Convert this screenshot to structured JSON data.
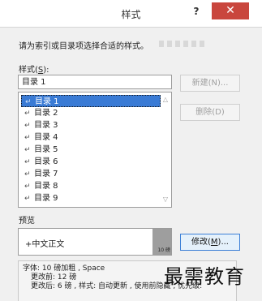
{
  "dialog": {
    "title": "样式",
    "help_label": "?",
    "close_label": "✕"
  },
  "instruction": "请为索引或目录项选择合适的样式。",
  "styles": {
    "label": "样式(",
    "label_key": "S",
    "label_end": "):",
    "current_value": "目录 1",
    "items": [
      {
        "label": "目录 1",
        "selected": true
      },
      {
        "label": "目录 2"
      },
      {
        "label": "目录 3"
      },
      {
        "label": "目录 4"
      },
      {
        "label": "目录 5"
      },
      {
        "label": "目录 6"
      },
      {
        "label": "目录 7"
      },
      {
        "label": "目录 8"
      },
      {
        "label": "目录 9"
      }
    ],
    "item_mark": "↵"
  },
  "buttons": {
    "new_label": "新建(N)...",
    "delete_label": "删除(D)",
    "modify_label": "修改(",
    "modify_key": "M",
    "modify_end": ")..."
  },
  "preview": {
    "label": "预览",
    "text": "+中文正文",
    "size_label": "10 磅"
  },
  "description": {
    "line1": "字体: 10 磅加粗 , Space",
    "line2": "更改前: 12 磅",
    "line3": "更改后: 6 磅 , 样式: 自动更新 , 使用前隐藏 , 优先级:"
  },
  "watermark": "最需教育"
}
